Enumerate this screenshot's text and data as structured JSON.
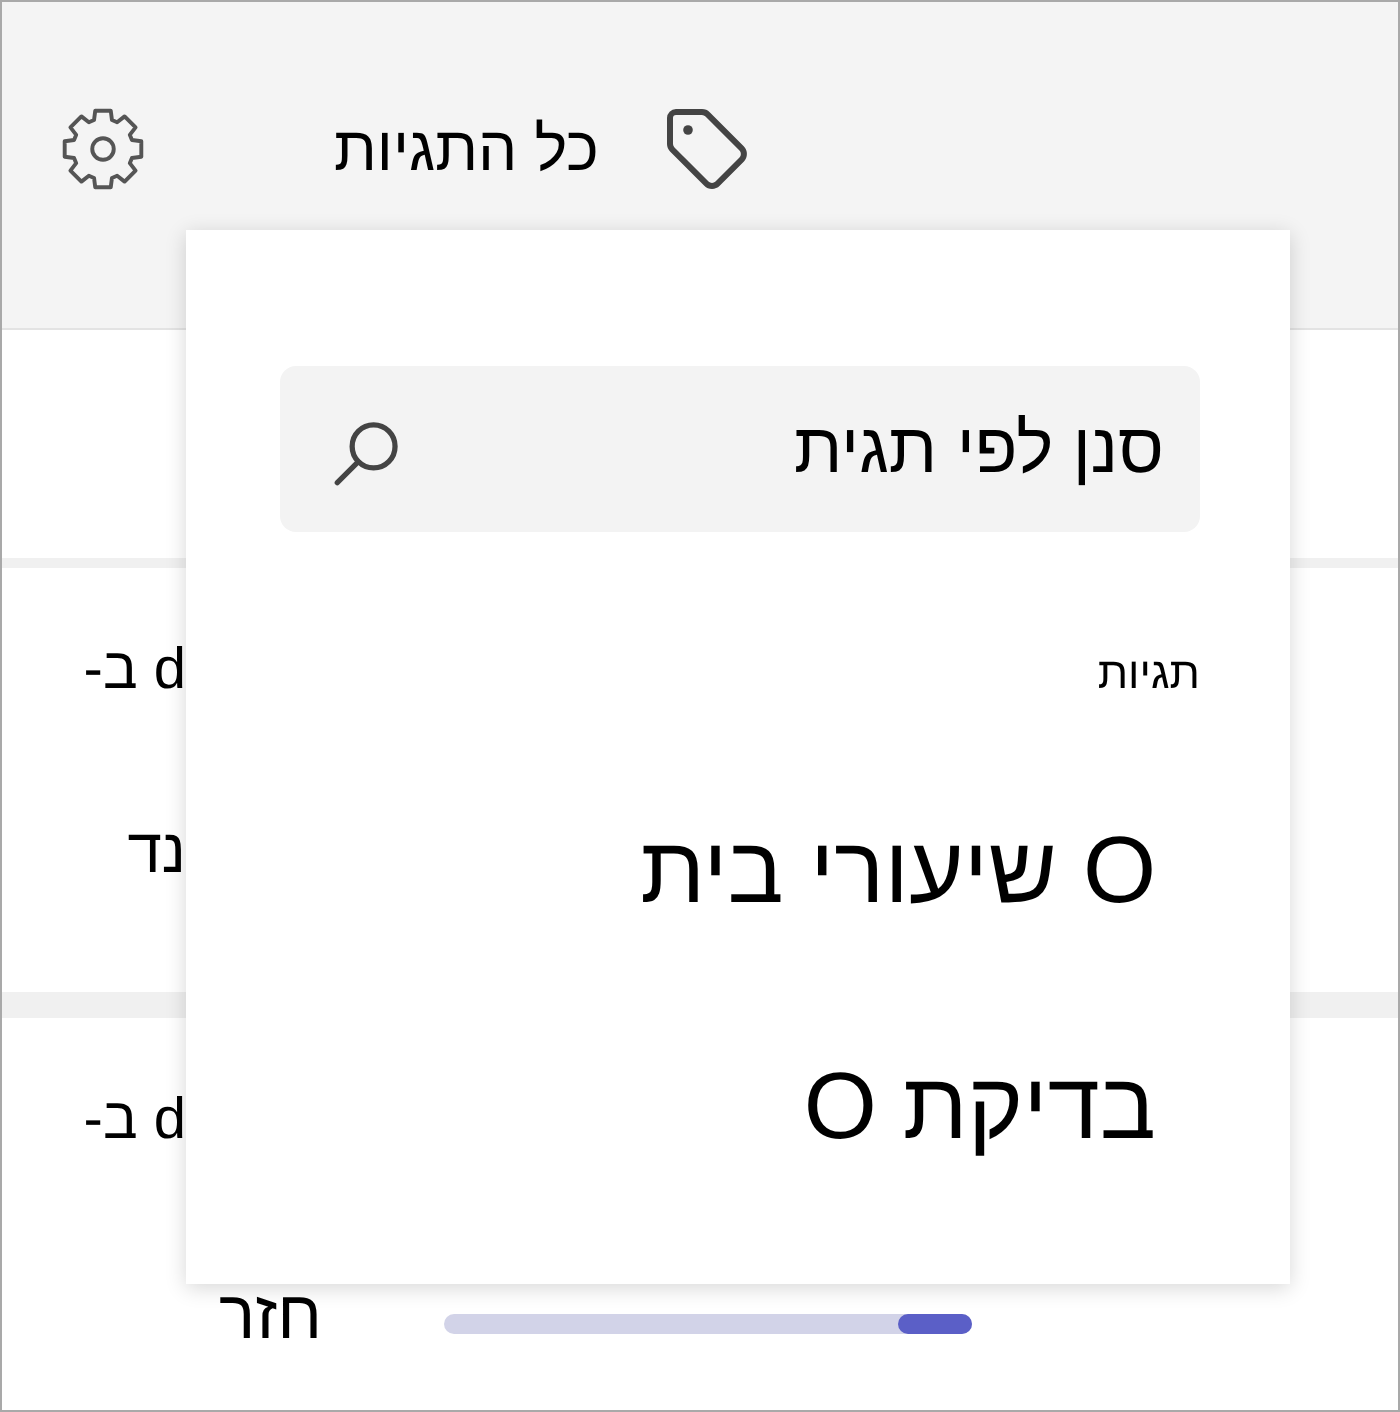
{
  "toolbar": {
    "title": "כל התגיות"
  },
  "background_rows": [
    {
      "title": "-ב d",
      "link": "נד"
    },
    {
      "title": "-ב d",
      "link": "חזר",
      "progress": {
        "level": 0.14
      }
    }
  ],
  "tag_menu": {
    "search": {
      "placeholder": "סנן לפי תגית"
    },
    "section_label": "תגיות",
    "tags": [
      {
        "label": "O שיעורי בית"
      },
      {
        "label": "בדיקת O"
      }
    ]
  }
}
